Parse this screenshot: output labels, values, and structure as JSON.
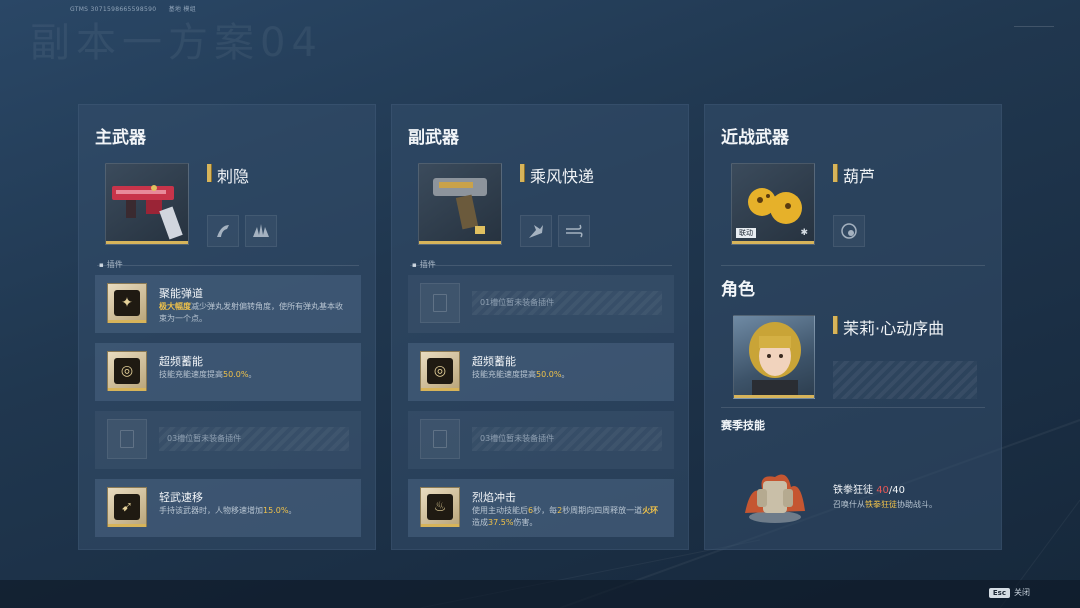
{
  "topbar": {
    "uid": "GTMS  3071598665598590",
    "extra": "基地  模组"
  },
  "bg_title": "副本一方案04",
  "panels": {
    "primary": {
      "title": "主武器",
      "weapon_name": "刺隐",
      "plugin_label": "插件",
      "slots": [
        {
          "title": "聚能弹道",
          "desc_hl": "极大幅度",
          "desc": "减少弹丸发射偏转角度，使所有弹丸基本收束为一个点。",
          "icon": "target-core-icon"
        },
        {
          "title": "超频蓄能",
          "desc": "技能充能速度提高",
          "value": "50.0%",
          "tail": "。",
          "icon": "energy-swirl-icon"
        },
        {
          "empty_text": "03槽位暂未装备插件"
        },
        {
          "title": "轻武速移",
          "desc": "手持该武器时，人物移速增加",
          "value": "15.0%",
          "tail": "。",
          "icon": "running-man-icon"
        }
      ]
    },
    "secondary": {
      "title": "副武器",
      "weapon_name": "乘风快递",
      "plugin_label": "插件",
      "slots": [
        {
          "empty_text": "01槽位暂未装备插件"
        },
        {
          "title": "超频蓄能",
          "desc": "技能充能速度提高",
          "value": "50.0%",
          "tail": "。",
          "icon": "energy-swirl-icon"
        },
        {
          "empty_text": "03槽位暂未装备插件"
        },
        {
          "title": "烈焰冲击",
          "desc1": "使用主动技能后",
          "v1": "6",
          "desc2": "秒，每",
          "v2": "2",
          "desc3": "秒周期向四周释放一道",
          "hl": "火环",
          "desc4": "造成",
          "v3": "37.5%",
          "desc5": "伤害。",
          "icon": "flame-icon"
        }
      ]
    },
    "melee": {
      "title": "近战武器",
      "weapon_name": "葫芦",
      "badge": "联动",
      "character_title": "角色",
      "character_name": "茉莉·心动序曲",
      "season_label": "赛季技能",
      "season_skill_name": "铁拳狂徒",
      "season_skill_count": "40",
      "season_skill_max": "/40",
      "season_desc_pre": "召唤什从",
      "season_desc_hl": "铁拳狂徒",
      "season_desc_post": "协助战斗。"
    }
  },
  "footer": {
    "key": "Esc",
    "label": "关闭"
  },
  "colors": {
    "accent": "#d7b45a",
    "highlight": "#f0c24a",
    "danger": "#e25757"
  }
}
